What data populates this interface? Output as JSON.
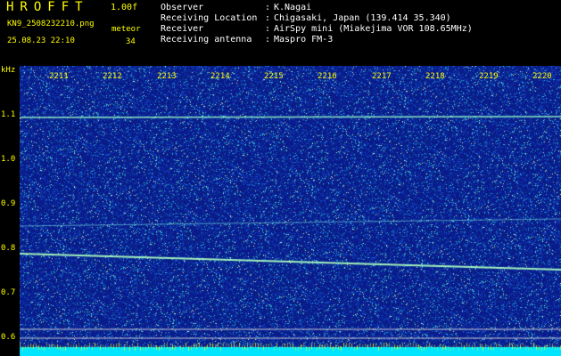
{
  "app": {
    "title": "HROFFT",
    "version": "1.00f",
    "filename": "KN9_2508232210.png",
    "datetime": "25.08.23 22:10",
    "meteor_label": "meteor",
    "meteor_count": "34"
  },
  "info": [
    {
      "key": "Observer",
      "value": "K.Nagai"
    },
    {
      "key": "Receiving Location",
      "value": "Chigasaki, Japan (139.414 35.340)"
    },
    {
      "key": "Receiver",
      "value": "AirSpy mini (Miakejima VOR 108.65MHz)"
    },
    {
      "key": "Receiving antenna",
      "value": "Maspro FM-3"
    }
  ],
  "info_separator": ":",
  "axis": {
    "y_unit": "kHz",
    "y_ticks": [
      "1.1",
      "1.0",
      "0.9",
      "0.8",
      "0.7",
      "0.6"
    ],
    "x_ticks": [
      "2211",
      "2212",
      "2213",
      "2214",
      "2215",
      "2216",
      "2217",
      "2218",
      "2219",
      "2220"
    ]
  },
  "colors": {
    "background": "#000000",
    "label": "#ffff00",
    "noise_base": "#0a1a8c",
    "signal": "#7fffd4"
  }
}
